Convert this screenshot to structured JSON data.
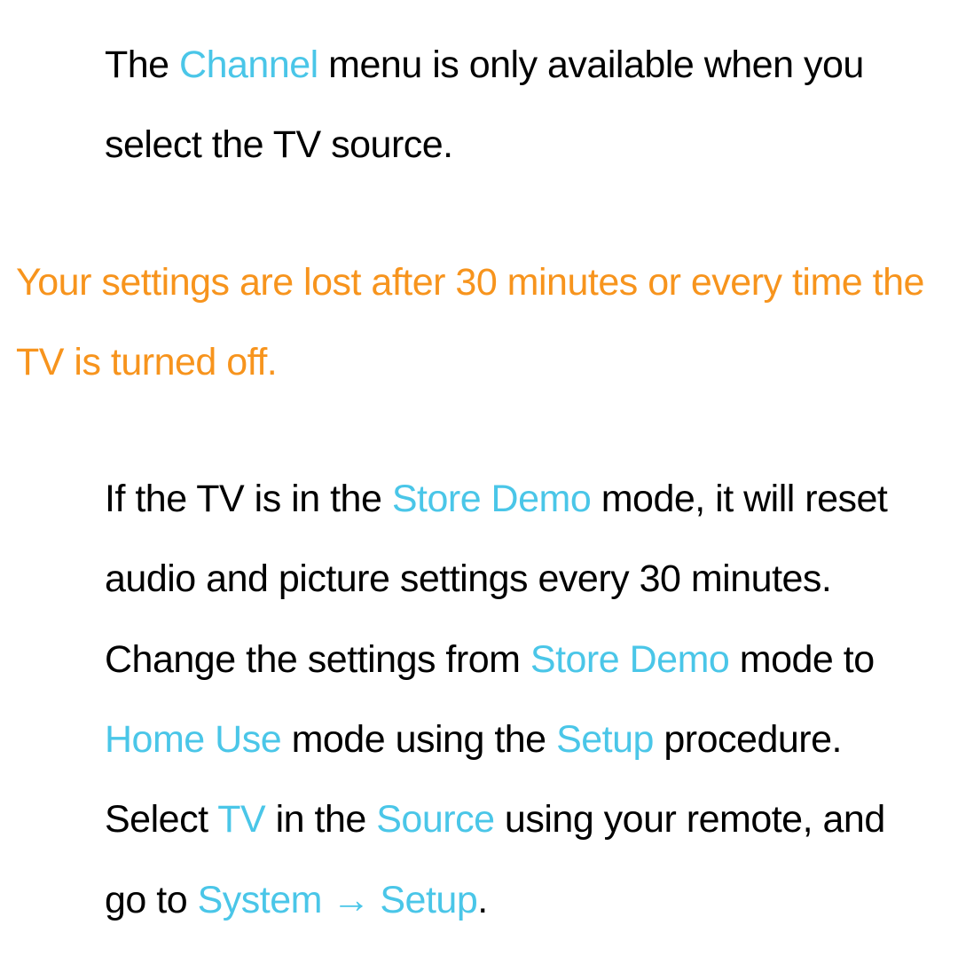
{
  "colors": {
    "accent": "#4ac6e8",
    "warning": "#f7941d",
    "text": "#000000"
  },
  "para1": {
    "t1": "The ",
    "channel": "Channel",
    "t2": " menu is only available when you select the TV source."
  },
  "para2": {
    "text": "Your settings are lost after 30 minutes or every time the TV is turned off."
  },
  "para3": {
    "t1": "If the TV is in the ",
    "store_demo": "Store Demo",
    "t2": " mode, it will reset audio and picture settings every 30 minutes. Change the settings from ",
    "store_demo2": "Store Demo",
    "t3": " mode to ",
    "home_use": "Home Use",
    "t4": " mode using the ",
    "setup": "Setup",
    "t5": " procedure. Select ",
    "tv": "TV",
    "t6": " in the ",
    "source": "Source",
    "t7": " using your remote, and go to ",
    "system": "System",
    "arrow": " → ",
    "setup2": "Setup",
    "t8": "."
  }
}
